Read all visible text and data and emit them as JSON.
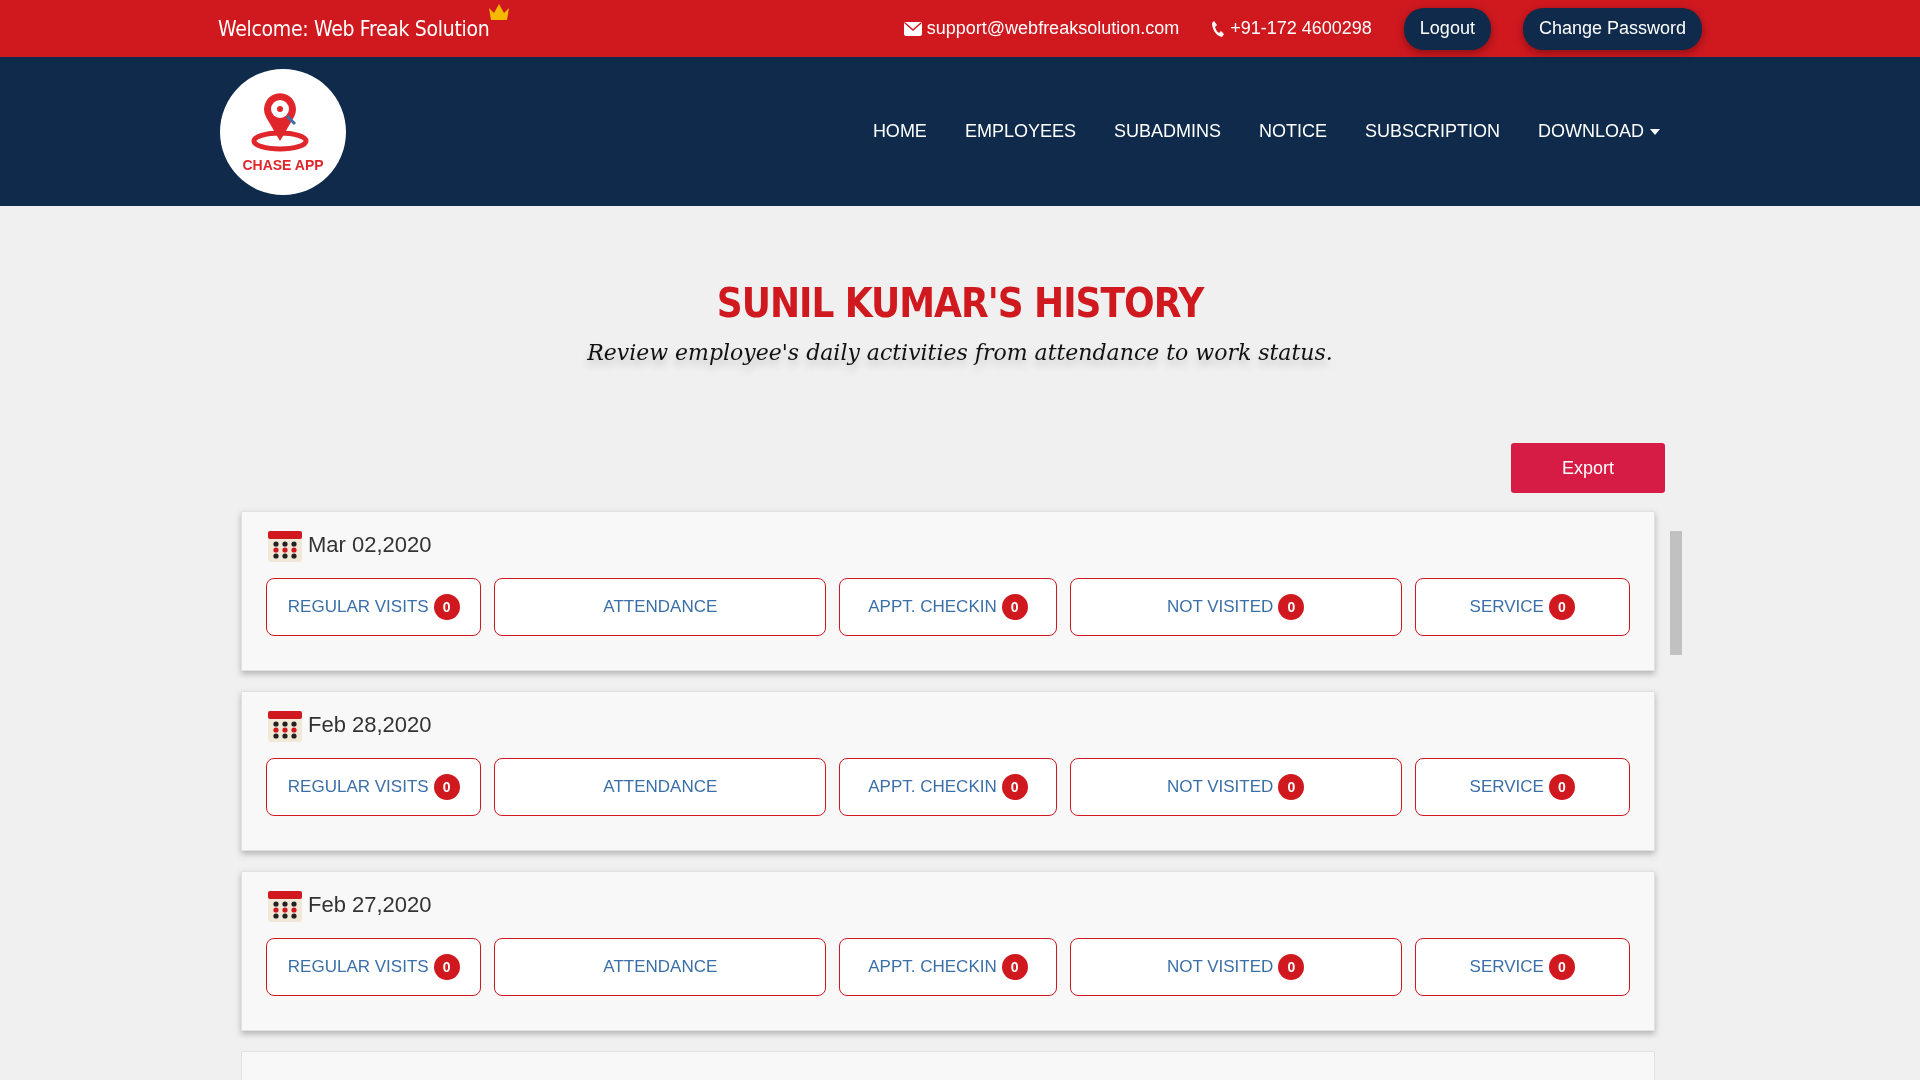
{
  "topbar": {
    "welcome": "Welcome: Web Freak Solution",
    "email": "support@webfreaksolution.com",
    "phone": "+91-172 4600298",
    "buttons": [
      "Logout",
      "Change Password"
    ]
  },
  "nav": {
    "logo_text": "CHASE APP",
    "items": [
      {
        "label": "HOME",
        "dropdown": false
      },
      {
        "label": "EMPLOYEES",
        "dropdown": false
      },
      {
        "label": "SUBADMINS",
        "dropdown": false
      },
      {
        "label": "NOTICE",
        "dropdown": false
      },
      {
        "label": "SUBSCRIPTION",
        "dropdown": false
      },
      {
        "label": "DOWNLOAD",
        "dropdown": true
      }
    ]
  },
  "page": {
    "title": "SUNIL KUMAR'S HISTORY",
    "subtitle": "Review employee's daily activities from attendance to work status.",
    "export": "Export"
  },
  "days": [
    {
      "date": "Mar 02,2020",
      "actions": [
        {
          "label": "REGULAR VISITS",
          "count": "0"
        },
        {
          "label": "ATTENDANCE"
        },
        {
          "label": "APPT. CHECKIN",
          "count": "0"
        },
        {
          "label": "NOT VISITED",
          "count": "0"
        },
        {
          "label": "SERVICE",
          "count": "0"
        }
      ]
    },
    {
      "date": "Feb 28,2020",
      "actions": [
        {
          "label": "REGULAR VISITS",
          "count": "0"
        },
        {
          "label": "ATTENDANCE"
        },
        {
          "label": "APPT. CHECKIN",
          "count": "0"
        },
        {
          "label": "NOT VISITED",
          "count": "0"
        },
        {
          "label": "SERVICE",
          "count": "0"
        }
      ]
    },
    {
      "date": "Feb 27,2020",
      "actions": [
        {
          "label": "REGULAR VISITS",
          "count": "0"
        },
        {
          "label": "ATTENDANCE"
        },
        {
          "label": "APPT. CHECKIN",
          "count": "0"
        },
        {
          "label": "NOT VISITED",
          "count": "0"
        },
        {
          "label": "SERVICE",
          "count": "0"
        }
      ]
    }
  ]
}
